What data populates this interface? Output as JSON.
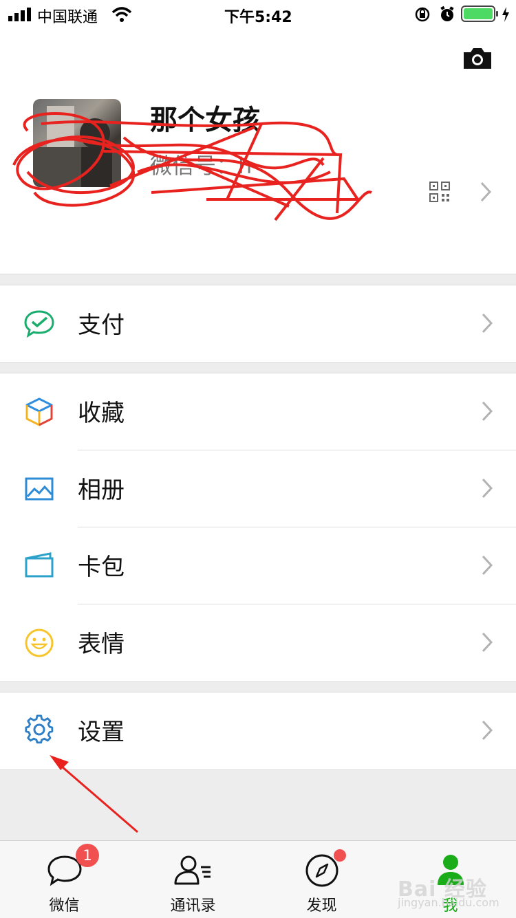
{
  "status_bar": {
    "carrier": "中国联通",
    "time": "下午5:42"
  },
  "profile": {
    "nickname": "那个女孩",
    "wechat_id": "微信号：h",
    "camera_icon": "camera-icon",
    "qr_icon": "qr-code-icon"
  },
  "menu": {
    "pay": "支付",
    "favorites": "收藏",
    "album": "相册",
    "cards": "卡包",
    "stickers": "表情",
    "settings": "设置"
  },
  "tabs": [
    {
      "label": "微信",
      "badge": "1"
    },
    {
      "label": "通讯录"
    },
    {
      "label": "发现"
    },
    {
      "label": "我"
    }
  ],
  "watermark": {
    "main": "Bai 经验",
    "sub": "jingyan.baidu.com"
  },
  "colors": {
    "accent": "#07c160",
    "badge": "#f05050",
    "annotation": "#e8231f"
  }
}
